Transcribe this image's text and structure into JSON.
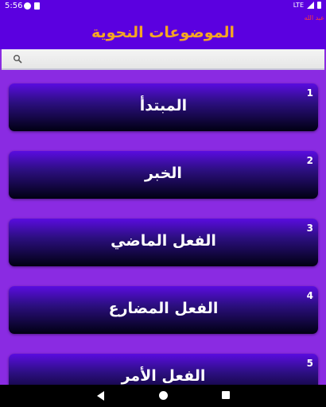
{
  "status_bar": {
    "time": "5:56",
    "network": "LTE"
  },
  "app_bar": {
    "title": "الموضوعات النحوية",
    "author": "عبد الله"
  },
  "search": {
    "placeholder": "",
    "value": ""
  },
  "topics": [
    {
      "number": "1",
      "title": "المبتدأ"
    },
    {
      "number": "2",
      "title": "الخبر"
    },
    {
      "number": "3",
      "title": "الفعل الماضي"
    },
    {
      "number": "4",
      "title": "الفعل المضارع"
    },
    {
      "number": "5",
      "title": "الفعل الأمر"
    }
  ],
  "colors": {
    "app_bar": "#5b00e0",
    "background": "#8a2be2",
    "title": "#f5a623",
    "author": "#ff3b3b",
    "card_top": "#5a0ce0",
    "card_bottom": "#000012"
  },
  "icons": {
    "search": "search-icon",
    "back": "back-triangle-icon",
    "home": "home-circle-icon",
    "recents": "recents-square-icon"
  }
}
